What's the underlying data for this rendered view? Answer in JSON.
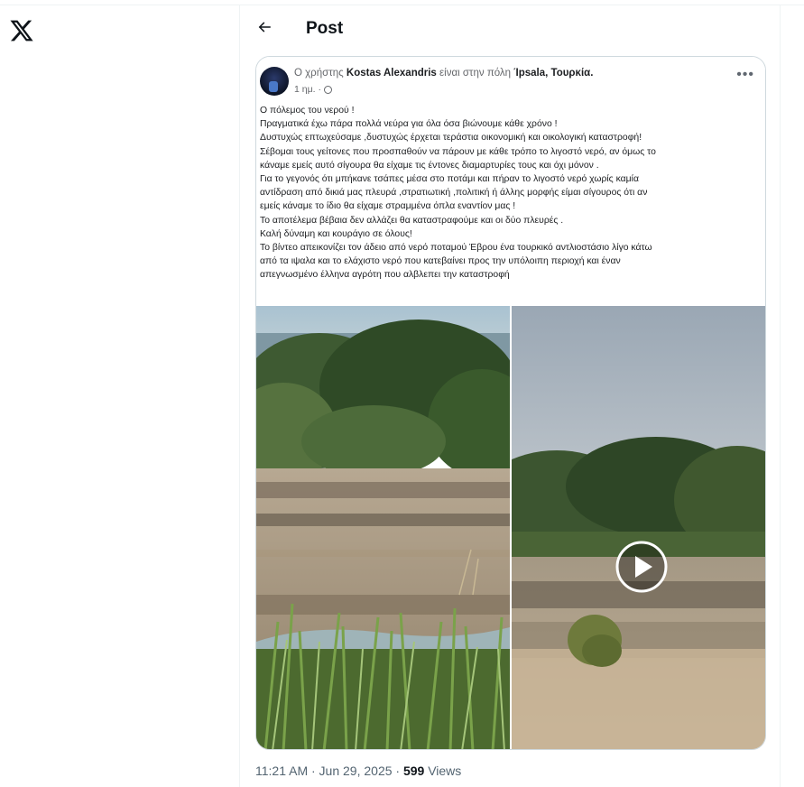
{
  "header": {
    "title": "Post"
  },
  "fb_post": {
    "prefix": "Ο χρήστης ",
    "author": "Kostas Alexandris",
    "middle": " είναι στην πόλη ",
    "location": "Ίpsala, Τουρκία.",
    "time": "1 ημ. ·",
    "more_label": "•••",
    "lines": [
      "Ο πόλεμος του νερού !",
      "Πραγματικά έχω πάρα πολλά νεύρα για όλα όσα  βιώνουμε κάθε χρόνο !",
      "Δυστυχώς επτωχεύσαμε ,δυστυχώς έρχεται τεράστια οικονομική  και  οικολογική καταστροφή!",
      "Σέβομαι τους γείτονες που προσπαθούν να πάρουν με κάθε τρόπο το λιγοστό νερό, αν όμως το",
      "κάναμε εμείς αυτό σίγουρα θα είχαμε τις έντονες διαμαρτυρίες τους και όχι μόνον .",
      "Για το γεγονός ότι μπήκανε τσάπες  μέσα στο ποτάμι και πήραν το λιγοστό  νερό χωρίς καμία",
      "αντίδραση από δικιά μας πλευρά ,στρατιωτική ,πολιτική ή άλλης μορφής είμαι σίγουρος ότι αν",
      "εμείς κάναμε  το ίδιο θα είχαμε στραμμένα όπλα εναντίον μας !",
      "Το αποτέλεμα βέβαια δεν αλλάζει θα καταστραφούμε και οι δύο πλευρές .",
      "Καλή δύναμη και κουράγιο σε όλους!",
      "Το βίντεο απεικονίζει τον άδειο από νερό ποταμού Έβρου ένα τουρκικό αντλιοστάσιο λίγο κάτω",
      "από τα ιψαλα και το ελάχιστο νερό που κατεβαίνει προς την υπόλοιπη περιοχή  και έναν",
      "απεγνωσμένο έλληνα αγρότη που αλβλεπει την καταστροφή"
    ]
  },
  "meta": {
    "timestamp": "11:21 AM · Jun 29, 2025 · ",
    "views_count": "599",
    "views_label": " Views"
  },
  "icons": {
    "logo": "x-logo-icon",
    "back": "arrow-left-icon",
    "play": "play-icon",
    "globe": "globe-icon"
  }
}
